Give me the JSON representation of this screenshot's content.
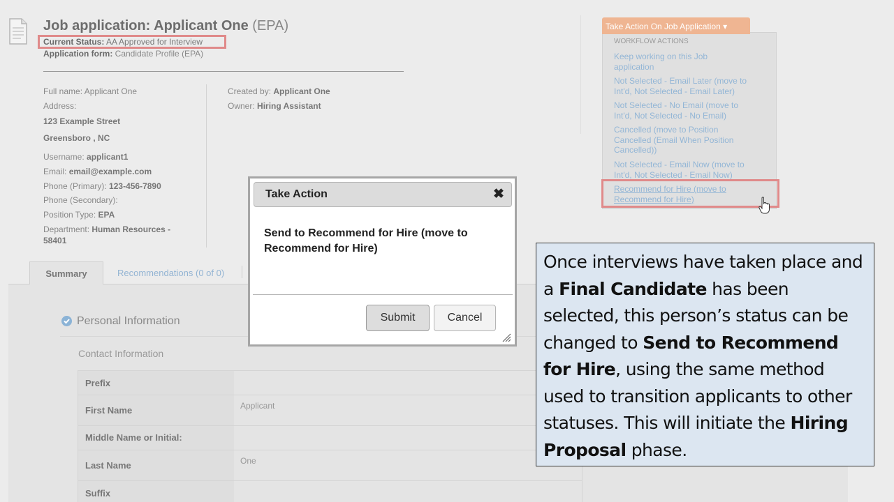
{
  "header": {
    "title_main": "Job application: Applicant One",
    "title_suffix": "(EPA)",
    "status_label": "Current Status:",
    "status_value": "AA Approved for Interview",
    "form_label": "Application form:",
    "form_value": "Candidate Profile (EPA)"
  },
  "applicant": {
    "fullname_label": "Full name:",
    "fullname_value": "Applicant One",
    "address_label": "Address:",
    "address_line1": "123 Example Street",
    "address_line2": "Greensboro , NC",
    "username_label": "Username:",
    "username_value": "applicant1",
    "email_label": "Email:",
    "email_value": "email@example.com",
    "phone_primary_label": "Phone (Primary):",
    "phone_primary_value": "123-456-7890",
    "phone_secondary_label": "Phone (Secondary):",
    "position_type_label": "Position Type:",
    "position_type_value": "EPA",
    "department_label": "Department:",
    "department_value_line1": "Human Resources -",
    "department_value_line2": "58401",
    "created_by_label": "Created by:",
    "created_by_value": "Applicant One",
    "owner_label": "Owner:",
    "owner_value": "Hiring Assistant"
  },
  "tabs": {
    "summary": "Summary",
    "recommendations": "Recommendations (0 of 0)"
  },
  "personal": {
    "section_title": "Personal Information",
    "contact_title": "Contact Information",
    "rows": [
      {
        "label": "Prefix",
        "value": ""
      },
      {
        "label": "First Name",
        "value": "Applicant"
      },
      {
        "label": "Middle Name or Initial:",
        "value": ""
      },
      {
        "label": "Last Name",
        "value": "One"
      },
      {
        "label": "Suffix",
        "value": ""
      }
    ]
  },
  "action_menu": {
    "button_label": "Take Action On Job Application ▾",
    "header": "WORKFLOW ACTIONS",
    "items": [
      {
        "line1": "Keep working on this Job",
        "line2": "application",
        "line3": ""
      },
      {
        "line1": "Not Selected - Email Later (move to",
        "line2": "Int'd, Not Selected - Email Later)",
        "line3": ""
      },
      {
        "line1": "Not Selected - No Email (move to",
        "line2": "Int'd, Not Selected - No Email)",
        "line3": ""
      },
      {
        "line1": "Cancelled (move to Position",
        "line2": "Cancelled (Email When Position",
        "line3": "Cancelled))"
      },
      {
        "line1": "Not Selected - Email Now (move to",
        "line2": "Int'd, Not Selected - Email Now)",
        "line3": ""
      },
      {
        "line1": "Recommend for Hire (move to",
        "line2": "Recommend for Hire)",
        "line3": ""
      }
    ]
  },
  "modal": {
    "title": "Take Action",
    "close_glyph": "✖",
    "message": "Send to Recommend for Hire (move to Recommend for Hire)",
    "submit_label": "Submit",
    "cancel_label": "Cancel"
  },
  "callout": {
    "p1": "Once interviews have taken place and a ",
    "b1": "Final Candidate",
    "p2": " has been selected, this person’s status can be changed to ",
    "b2": "Send to Recommend for Hire",
    "p3": ", using the same method used to transition applicants to other statuses.  This will initiate the ",
    "b3": "Hiring Proposal",
    "p4": " phase."
  },
  "colors": {
    "highlight": "#e08a8a",
    "action_button": "#efb592",
    "link": "#93b6d6",
    "callout_bg": "#dce6f1"
  }
}
